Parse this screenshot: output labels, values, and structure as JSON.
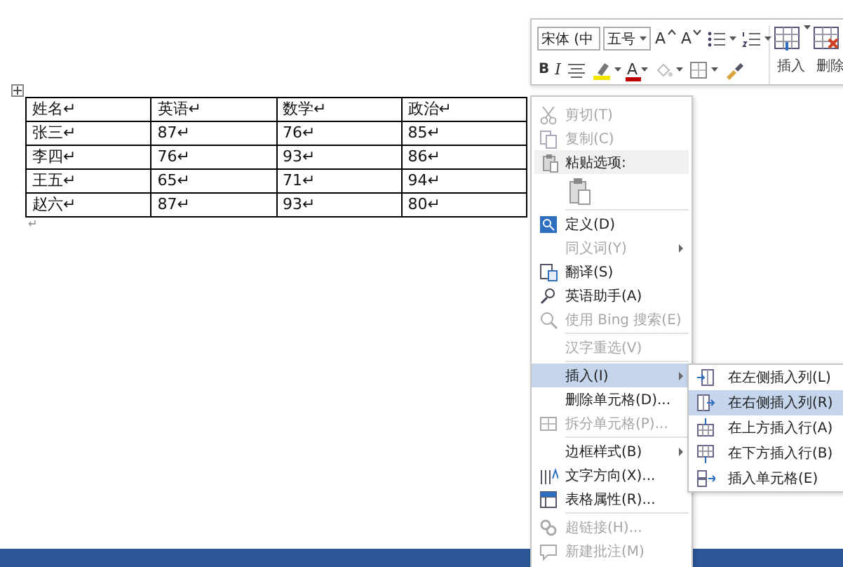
{
  "table": {
    "columns": [
      "姓名↵",
      "英语↵",
      "数学↵",
      "政治↵"
    ],
    "rows": [
      [
        "张三↵",
        "87↵",
        "76↵",
        "85↵"
      ],
      [
        "李四↵",
        "76↵",
        "93↵",
        "86↵"
      ],
      [
        "王五↵",
        "65↵",
        "71↵",
        "94↵"
      ],
      [
        "赵六↵",
        "87↵",
        "93↵",
        "80↵"
      ]
    ],
    "after_mark": "↵"
  },
  "mini_toolbar": {
    "font": "宋体 (中",
    "size": "五号",
    "top_buttons": [
      {
        "kind": "grow",
        "label": "A"
      },
      {
        "kind": "shrink",
        "label": "A"
      },
      {
        "kind": "bullets"
      },
      {
        "kind": "numbering"
      }
    ],
    "format_buttons": [
      {
        "kind": "bold",
        "label": "B"
      },
      {
        "kind": "italic",
        "label": "I"
      },
      {
        "kind": "center"
      },
      {
        "kind": "highlight"
      },
      {
        "kind": "font-color",
        "label": "A"
      },
      {
        "kind": "shading"
      },
      {
        "kind": "borders"
      },
      {
        "kind": "painter"
      }
    ],
    "big_buttons": [
      {
        "kind": "insert",
        "label": "插入"
      },
      {
        "kind": "delete",
        "label": "删除"
      }
    ]
  },
  "context_menu": {
    "items": [
      {
        "kind": "item",
        "label": "剪切(T)",
        "disabled": true,
        "highlighted": false,
        "submenu": false
      },
      {
        "kind": "item",
        "label": "复制(C)",
        "disabled": true,
        "highlighted": false,
        "submenu": false
      },
      {
        "kind": "header",
        "label": "粘贴选项:"
      },
      {
        "kind": "paste-options"
      },
      {
        "kind": "separator"
      },
      {
        "kind": "item",
        "label": "定义(D)",
        "disabled": false,
        "highlighted": false,
        "submenu": false
      },
      {
        "kind": "item",
        "label": "同义词(Y)",
        "disabled": true,
        "highlighted": false,
        "submenu": true
      },
      {
        "kind": "item",
        "label": "翻译(S)",
        "disabled": false,
        "highlighted": false,
        "submenu": false
      },
      {
        "kind": "item",
        "label": "英语助手(A)",
        "disabled": false,
        "highlighted": false,
        "submenu": false
      },
      {
        "kind": "item",
        "label": "使用 Bing 搜索(E)",
        "disabled": true,
        "highlighted": false,
        "submenu": false
      },
      {
        "kind": "separator"
      },
      {
        "kind": "item",
        "label": "汉字重选(V)",
        "disabled": true,
        "highlighted": false,
        "submenu": false
      },
      {
        "kind": "separator"
      },
      {
        "kind": "item",
        "label": "插入(I)",
        "disabled": false,
        "highlighted": true,
        "submenu": true
      },
      {
        "kind": "item",
        "label": "删除单元格(D)...",
        "disabled": false,
        "highlighted": false,
        "submenu": false
      },
      {
        "kind": "item",
        "label": "拆分单元格(P)...",
        "disabled": true,
        "highlighted": false,
        "submenu": false
      },
      {
        "kind": "separator"
      },
      {
        "kind": "item",
        "label": "边框样式(B)",
        "disabled": false,
        "highlighted": false,
        "submenu": true
      },
      {
        "kind": "item",
        "label": "文字方向(X)...",
        "disabled": false,
        "highlighted": false,
        "submenu": false
      },
      {
        "kind": "item",
        "label": "表格属性(R)...",
        "disabled": false,
        "highlighted": false,
        "submenu": false
      },
      {
        "kind": "separator"
      },
      {
        "kind": "item",
        "label": "超链接(H)...",
        "disabled": true,
        "highlighted": false,
        "submenu": false
      },
      {
        "kind": "item",
        "label": "新建批注(M)",
        "disabled": true,
        "highlighted": false,
        "submenu": false
      }
    ]
  },
  "submenu": {
    "items": [
      {
        "label": "在左侧插入列(L)",
        "highlighted": false
      },
      {
        "label": "在右侧插入列(R)",
        "highlighted": true
      },
      {
        "label": "在上方插入行(A)",
        "highlighted": false
      },
      {
        "label": "在下方插入行(B)",
        "highlighted": false
      },
      {
        "label": "插入单元格(E)",
        "highlighted": false
      }
    ]
  }
}
